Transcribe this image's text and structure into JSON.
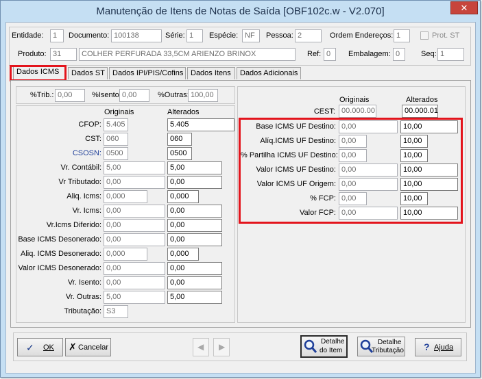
{
  "window": {
    "title": "Manutenção de Itens de Notas de Saída [OBF102c.w - V2.070]",
    "close": "✕"
  },
  "header": {
    "entidade_label": "Entidade:",
    "entidade": "1",
    "documento_label": "Documento:",
    "documento": "100138",
    "serie_label": "Série:",
    "serie": "1",
    "especie_label": "Espécie:",
    "especie": "NF",
    "pessoa_label": "Pessoa:",
    "pessoa": "2",
    "ordem_label": "Ordem Endereços:",
    "ordem": "1",
    "prot_label": "Prot. ST",
    "produto_label": "Produto:",
    "produto_code": "31",
    "produto_desc": "COLHER PERFURADA 33,5CM ARIENZO BRINOX",
    "ref_label": "Ref:",
    "ref": "0",
    "embalagem_label": "Embalagem:",
    "embalagem": "0",
    "seq_label": "Seq:",
    "seq": "1"
  },
  "tabs": [
    "Dados ICMS",
    "Dados ST",
    "Dados IPI/PIS/Cofins",
    "Dados Itens",
    "Dados Adicionais"
  ],
  "percent": {
    "trib_label": "%Trib.:",
    "trib": "0,00",
    "isento_label": "%Isento:",
    "isento": "0,00",
    "outras_label": "%Outras:",
    "outras": "100,00"
  },
  "left": {
    "col_orig": "Originais",
    "col_alt": "Alterados",
    "rows": [
      {
        "label": "CFOP:",
        "orig": "5.405",
        "alt": "5.405"
      },
      {
        "label": "CST:",
        "orig": "060",
        "alt": "060"
      },
      {
        "label": "CSOSN:",
        "orig": "0500",
        "alt": "0500"
      },
      {
        "label": "Vr. Contábil:",
        "orig": "5,00",
        "alt": "5,00"
      },
      {
        "label": "Vr Tributado:",
        "orig": "0,00",
        "alt": "0,00"
      },
      {
        "label": "Aliq. Icms:",
        "orig": "0,000",
        "alt": "0,000"
      },
      {
        "label": "Vr. Icms:",
        "orig": "0,00",
        "alt": "0,00"
      },
      {
        "label": "Vr.Icms Diferido:",
        "orig": "0,00",
        "alt": "0,00"
      },
      {
        "label": "Base ICMS Desonerado:",
        "orig": "0,00",
        "alt": "0,00"
      },
      {
        "label": "Aliq. ICMS Desonerado:",
        "orig": "0,000",
        "alt": "0,000"
      },
      {
        "label": "Valor ICMS Desonerado:",
        "orig": "0,00",
        "alt": "0,00"
      },
      {
        "label": "Vr. Isento:",
        "orig": "0,00",
        "alt": "0,00"
      },
      {
        "label": "Vr. Outras:",
        "orig": "5,00",
        "alt": "5,00"
      },
      {
        "label": "Tributação:",
        "orig": "S3",
        "alt": ""
      }
    ]
  },
  "right": {
    "col_orig": "Originais",
    "col_alt": "Alterados",
    "cest_label": "CEST:",
    "cest_orig": "00.000.00",
    "cest_alt": "00.000.01",
    "rows": [
      {
        "label": "Base ICMS UF Destino:",
        "orig": "0,00",
        "alt": "10,00"
      },
      {
        "label": "Alíq.ICMS UF Destino:",
        "orig": "0,00",
        "alt": "10,00"
      },
      {
        "label": "% Partilha ICMS UF Destino:",
        "orig": "0,00",
        "alt": "10,00"
      },
      {
        "label": "Valor ICMS UF Destino:",
        "orig": "0,00",
        "alt": "10,00"
      },
      {
        "label": "Valor ICMS UF Origem:",
        "orig": "0,00",
        "alt": "10,00"
      },
      {
        "label": "% FCP:",
        "orig": "0,00",
        "alt": "10,00"
      },
      {
        "label": "Valor FCP:",
        "orig": "0,00",
        "alt": "10,00"
      }
    ]
  },
  "footer": {
    "ok": "OK",
    "cancel": "Cancelar",
    "detalhe_item_1": "Detalhe",
    "detalhe_item_2": "do Item",
    "detalhe_trib_1": "Detalhe",
    "detalhe_trib_2": "Tributação",
    "ajuda": "Ajuda"
  },
  "colors": {
    "title_bar": "#c5dff3",
    "highlight": "#e3141c",
    "csosn_label": "#1f3f99"
  }
}
